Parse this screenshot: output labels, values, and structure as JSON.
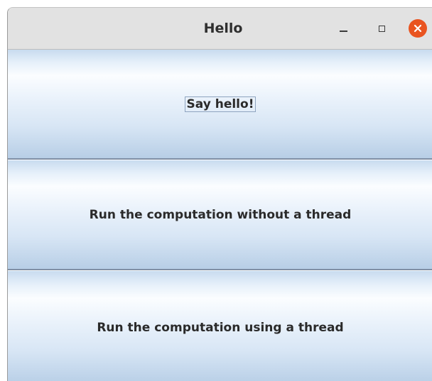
{
  "window": {
    "title": "Hello",
    "controls": {
      "minimize_icon": "minimize-icon",
      "maximize_icon": "maximize-icon",
      "close_icon": "close-icon",
      "close_color": "#e95420"
    }
  },
  "buttons": [
    {
      "label": "Say hello!",
      "focused": true
    },
    {
      "label": "Run the computation without a thread",
      "focused": false
    },
    {
      "label": "Run the computation using a thread",
      "focused": false
    }
  ]
}
